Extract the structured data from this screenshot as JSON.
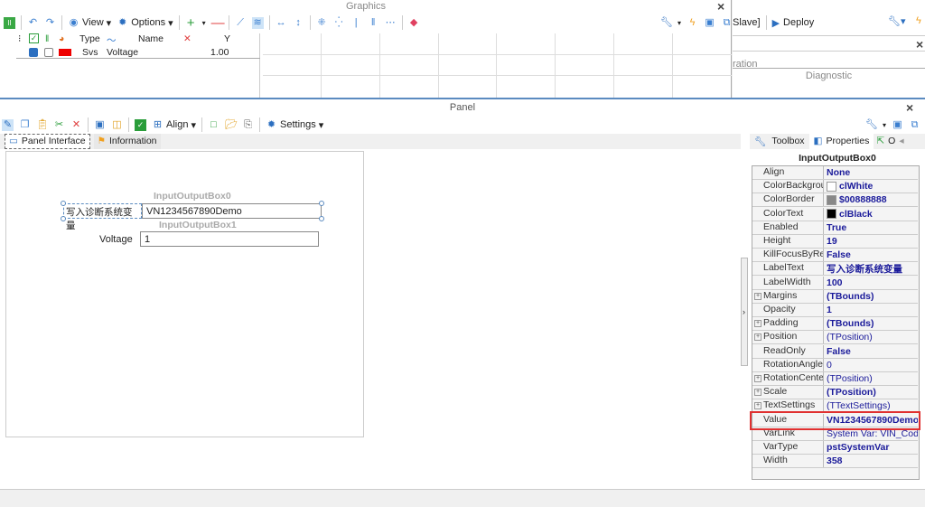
{
  "graphics": {
    "title": "Graphics",
    "toolbar": {
      "view": "View",
      "options": "Options"
    },
    "table": {
      "headers": {
        "type": "Type",
        "name": "Name",
        "y": "Y"
      },
      "rows": [
        {
          "type": "Svs",
          "name": "Voltage",
          "y": "1.00",
          "color": "#ee0000"
        }
      ]
    }
  },
  "background_window": {
    "toolbar_text": "Slave]",
    "deploy": "Deploy",
    "partial_tab": "ration",
    "diagnostic": "Diagnostic"
  },
  "panel": {
    "title": "Panel",
    "toolbar": {
      "align": "Align",
      "settings": "Settings"
    },
    "tabs": [
      {
        "label": "Panel Interface"
      },
      {
        "label": "Information"
      }
    ],
    "canvas": {
      "box0": {
        "name": "InputOutputBox0",
        "label": "写入诊断系统变量",
        "value": "VN1234567890Demo"
      },
      "box1": {
        "name": "InputOutputBox1",
        "label": "Voltage",
        "value": "1"
      }
    },
    "side_tabs": [
      {
        "label": "Toolbox"
      },
      {
        "label": "Properties"
      },
      {
        "label": "O"
      }
    ],
    "inspector_title": "InputOutputBox0",
    "properties": [
      {
        "key": "Align",
        "value": "None",
        "bold": true
      },
      {
        "key": "ColorBackgrour",
        "value": "clWhite",
        "bold": true,
        "swatch": "#ffffff"
      },
      {
        "key": "ColorBorder",
        "value": "$00888888",
        "bold": true,
        "swatch": "#888888"
      },
      {
        "key": "ColorText",
        "value": "clBlack",
        "bold": true,
        "swatch": "#000000"
      },
      {
        "key": "Enabled",
        "value": "True",
        "bold": true
      },
      {
        "key": "Height",
        "value": "19",
        "bold": true
      },
      {
        "key": "KillFocusByRetu",
        "value": "False",
        "bold": true
      },
      {
        "key": "LabelText",
        "value": "写入诊断系统变量",
        "bold": true
      },
      {
        "key": "LabelWidth",
        "value": "100",
        "bold": true
      },
      {
        "key": "Margins",
        "value": "(TBounds)",
        "bold": true,
        "expand": true
      },
      {
        "key": "Opacity",
        "value": "1",
        "bold": true
      },
      {
        "key": "Padding",
        "value": "(TBounds)",
        "bold": true,
        "expand": true
      },
      {
        "key": "Position",
        "value": "(TPosition)",
        "bold": false,
        "expand": true
      },
      {
        "key": "ReadOnly",
        "value": "False",
        "bold": true
      },
      {
        "key": "RotationAngle",
        "value": "0",
        "bold": false
      },
      {
        "key": "RotationCenter",
        "value": "(TPosition)",
        "bold": false,
        "expand": true
      },
      {
        "key": "Scale",
        "value": "(TPosition)",
        "bold": true,
        "expand": true
      },
      {
        "key": "TextSettings",
        "value": "(TTextSettings)",
        "bold": false,
        "expand": true
      },
      {
        "key": "Value",
        "value": "VN1234567890Demo",
        "bold": true,
        "highlight": true
      },
      {
        "key": "VarLink",
        "value": "System Var: VIN_Code",
        "bold": false
      },
      {
        "key": "VarType",
        "value": "pstSystemVar",
        "bold": true
      },
      {
        "key": "Width",
        "value": "358",
        "bold": true
      }
    ]
  }
}
